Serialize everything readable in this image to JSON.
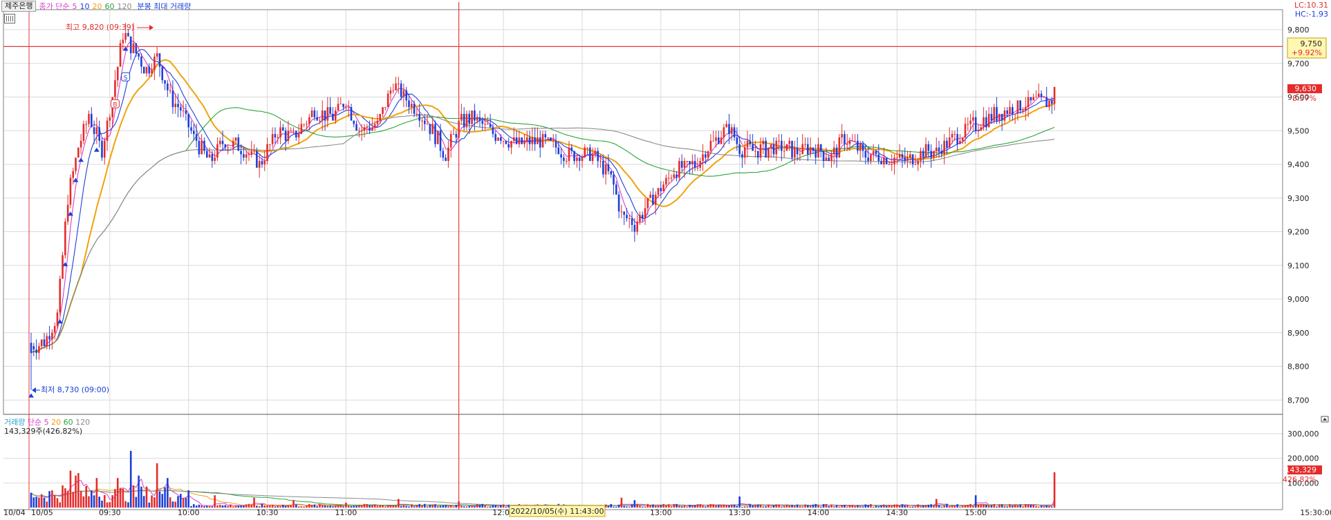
{
  "header": {
    "stock_name": "제주은행",
    "price_label": "종가 단순",
    "ma_periods": [
      "5",
      "10",
      "20",
      "60",
      "120"
    ],
    "chart_mode": "분봉 최대 거래량"
  },
  "volume_header": {
    "label": "거래량",
    "ma_label": "단순",
    "ma_periods": [
      "5",
      "20",
      "60",
      "120"
    ],
    "value_text": "143,329주(426.82%)"
  },
  "lc_hc": {
    "lc": "LC:10.31",
    "hc": "HC:-1.93"
  },
  "crosshair": {
    "price_label": "9,750",
    "pct_label": "+9.92%",
    "time_label": "2022/10/05(수) 11:43:00"
  },
  "current": {
    "price_label": "9,630",
    "pct_label": "8.57%"
  },
  "volume_current": {
    "value_label": "143,329",
    "pct_label": "426.82%"
  },
  "annotations": {
    "high": "최고 9,820 (09:39)",
    "low": "최저 8,730 (09:00)",
    "buy_marker": "B",
    "sell_marker": "S"
  },
  "colors": {
    "up": "#e52b2b",
    "down": "#1c3fd8",
    "ma5": "#d43fc8",
    "ma10": "#1c3fd8",
    "ma20": "#f0a20c",
    "ma60": "#2ba33a",
    "ma120": "#8a8a8a",
    "crosshair": "#e33b3b",
    "grid": "#d9d9d9"
  },
  "chart_data": [
    {
      "type": "candlestick",
      "title": "제주은행",
      "x_tick_labels": [
        "10/04",
        "10/05",
        "09:30",
        "10:00",
        "10:30",
        "11:00",
        "12:00",
        "12:30",
        "13:00",
        "13:30",
        "14:00",
        "14:30",
        "15:00",
        "15:30:00"
      ],
      "y_tick_labels": [
        "9,800",
        "9,700",
        "9,600",
        "9,500",
        "9,400",
        "9,300",
        "9,200",
        "9,100",
        "9,000",
        "8,900",
        "8,800",
        "8,700"
      ],
      "ylim": [
        8650,
        9880
      ],
      "high": 9820,
      "high_time": "09:39",
      "low": 8730,
      "low_time": "09:00",
      "current": 9630,
      "crosshair_price": 9750,
      "anchors": [
        {
          "t": "09:00",
          "p": 8860
        },
        {
          "t": "09:05",
          "p": 8870
        },
        {
          "t": "09:10",
          "p": 8950
        },
        {
          "t": "09:14",
          "p": 9300
        },
        {
          "t": "09:18",
          "p": 9450
        },
        {
          "t": "09:22",
          "p": 9550
        },
        {
          "t": "09:27",
          "p": 9440
        },
        {
          "t": "09:31",
          "p": 9600
        },
        {
          "t": "09:35",
          "p": 9790
        },
        {
          "t": "09:39",
          "p": 9740
        },
        {
          "t": "09:44",
          "p": 9680
        },
        {
          "t": "09:48",
          "p": 9720
        },
        {
          "t": "09:53",
          "p": 9600
        },
        {
          "t": "09:57",
          "p": 9560
        },
        {
          "t": "10:02",
          "p": 9480
        },
        {
          "t": "10:08",
          "p": 9410
        },
        {
          "t": "10:14",
          "p": 9470
        },
        {
          "t": "10:20",
          "p": 9450
        },
        {
          "t": "10:27",
          "p": 9400
        },
        {
          "t": "10:34",
          "p": 9500
        },
        {
          "t": "10:40",
          "p": 9480
        },
        {
          "t": "10:48",
          "p": 9560
        },
        {
          "t": "10:55",
          "p": 9540
        },
        {
          "t": "11:00",
          "p": 9590
        },
        {
          "t": "11:05",
          "p": 9500
        },
        {
          "t": "11:12",
          "p": 9520
        },
        {
          "t": "11:18",
          "p": 9640
        },
        {
          "t": "11:23",
          "p": 9590
        },
        {
          "t": "11:27",
          "p": 9570
        },
        {
          "t": "11:33",
          "p": 9500
        },
        {
          "t": "11:38",
          "p": 9430
        },
        {
          "t": "11:43",
          "p": 9520
        },
        {
          "t": "11:48",
          "p": 9540
        },
        {
          "t": "11:55",
          "p": 9500
        },
        {
          "t": "12:05",
          "p": 9460
        },
        {
          "t": "12:15",
          "p": 9470
        },
        {
          "t": "12:25",
          "p": 9430
        },
        {
          "t": "12:33",
          "p": 9430
        },
        {
          "t": "12:37",
          "p": 9400
        },
        {
          "t": "12:41",
          "p": 9360
        },
        {
          "t": "12:45",
          "p": 9250
        },
        {
          "t": "12:50",
          "p": 9220
        },
        {
          "t": "12:56",
          "p": 9290
        },
        {
          "t": "13:05",
          "p": 9380
        },
        {
          "t": "13:13",
          "p": 9400
        },
        {
          "t": "13:19",
          "p": 9460
        },
        {
          "t": "13:26",
          "p": 9510
        },
        {
          "t": "13:30",
          "p": 9450
        },
        {
          "t": "13:36",
          "p": 9440
        },
        {
          "t": "13:45",
          "p": 9450
        },
        {
          "t": "13:52",
          "p": 9440
        },
        {
          "t": "13:58",
          "p": 9450
        },
        {
          "t": "14:05",
          "p": 9420
        },
        {
          "t": "14:10",
          "p": 9480
        },
        {
          "t": "14:17",
          "p": 9430
        },
        {
          "t": "14:26",
          "p": 9420
        },
        {
          "t": "14:33",
          "p": 9410
        },
        {
          "t": "14:40",
          "p": 9440
        },
        {
          "t": "14:45",
          "p": 9440
        },
        {
          "t": "14:52",
          "p": 9480
        },
        {
          "t": "15:00",
          "p": 9520
        },
        {
          "t": "15:05",
          "p": 9540
        },
        {
          "t": "15:12",
          "p": 9560
        },
        {
          "t": "15:20",
          "p": 9580
        },
        {
          "t": "15:30",
          "p": 9590
        }
      ],
      "ma_series": [
        "5",
        "10",
        "20",
        "60",
        "120"
      ]
    },
    {
      "type": "bar",
      "title": "거래량",
      "y_tick_labels": [
        "300,000",
        "200,000",
        "100,000"
      ],
      "ylim": [
        0,
        360000
      ],
      "last_volume": 143329,
      "spikes": [
        {
          "t": "09:00",
          "v": 60000
        },
        {
          "t": "09:12",
          "v": 90000
        },
        {
          "t": "09:15",
          "v": 150000
        },
        {
          "t": "09:17",
          "v": 130000
        },
        {
          "t": "09:18",
          "v": 140000
        },
        {
          "t": "09:25",
          "v": 120000
        },
        {
          "t": "09:33",
          "v": 120000
        },
        {
          "t": "09:38",
          "v": 230000
        },
        {
          "t": "09:41",
          "v": 130000
        },
        {
          "t": "09:48",
          "v": 180000
        },
        {
          "t": "09:52",
          "v": 120000
        },
        {
          "t": "10:00",
          "v": 70000
        },
        {
          "t": "10:10",
          "v": 50000
        },
        {
          "t": "10:25",
          "v": 40000
        },
        {
          "t": "10:40",
          "v": 30000
        },
        {
          "t": "11:00",
          "v": 20000
        },
        {
          "t": "11:20",
          "v": 35000
        },
        {
          "t": "11:43",
          "v": 25000
        },
        {
          "t": "12:45",
          "v": 40000
        },
        {
          "t": "12:50",
          "v": 30000
        },
        {
          "t": "13:30",
          "v": 45000
        },
        {
          "t": "14:45",
          "v": 35000
        },
        {
          "t": "15:00",
          "v": 50000
        },
        {
          "t": "15:30",
          "v": 143329
        }
      ]
    }
  ]
}
